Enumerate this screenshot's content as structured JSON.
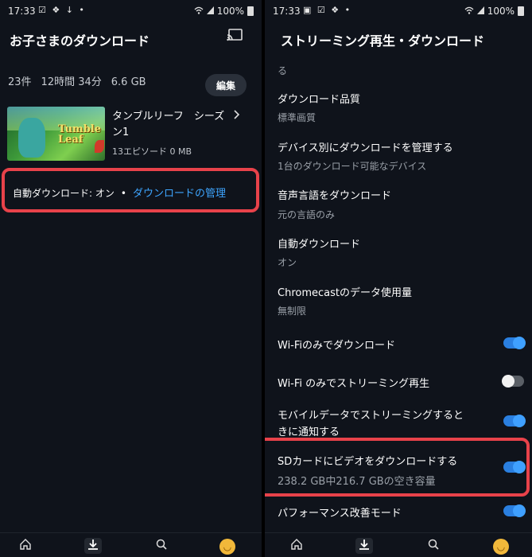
{
  "left": {
    "status": {
      "time": "17:33",
      "notif": "☑ ❖ ↓ •",
      "battery": "100%"
    },
    "title": "お子さまのダウンロード",
    "summary": {
      "count": "23件",
      "duration": "12時間 34分",
      "size": "6.6 GB"
    },
    "edit_label": "編集",
    "item": {
      "title": "タンブルリーフ　シーズン1",
      "meta": "13エピソード 0 MB",
      "thumb_logo_line1": "Tumble",
      "thumb_logo_line2": "Leaf"
    },
    "auto": {
      "status": "自動ダウンロード: オン",
      "dot": "•",
      "link": "ダウンロードの管理"
    }
  },
  "right": {
    "status": {
      "time": "17:33",
      "notif": "▣ ☑ ❖ •",
      "battery": "100%"
    },
    "title": "ストリーミング再生・ダウンロード",
    "fragment": "る",
    "settings": [
      {
        "label": "ダウンロード品質",
        "value": "標準画質"
      },
      {
        "label": "デバイス別にダウンロードを管理する",
        "value": "1台のダウンロード可能なデバイス"
      },
      {
        "label": "音声言語をダウンロード",
        "value": "元の言語のみ"
      },
      {
        "label": "自動ダウンロード",
        "value": "オン"
      },
      {
        "label": "Chromecastのデータ使用量",
        "value": "無制限"
      }
    ],
    "toggles": [
      {
        "label": "Wi-Fiのみでダウンロード",
        "state": "on"
      },
      {
        "label": "Wi-Fi のみでストリーミング再生",
        "state": "off"
      },
      {
        "label_line1": "モバイルデータでストリーミングすると",
        "label_line2": "きに通知する",
        "state": "on"
      },
      {
        "label": "SDカードにビデオをダウンロードする",
        "value": "238.2 GB中216.7 GBの空き容量",
        "state": "on"
      },
      {
        "label": "パフォーマンス改善モード",
        "state": "on"
      }
    ]
  },
  "nav": {
    "home": "⌂",
    "downloads": "⬇",
    "search": "⚲",
    "avatar": "◡"
  },
  "colors": {
    "background": "#0f131b",
    "accent": "#3ea5ff",
    "highlight": "#e8424a",
    "toggle_on": "#2a7fe0"
  }
}
